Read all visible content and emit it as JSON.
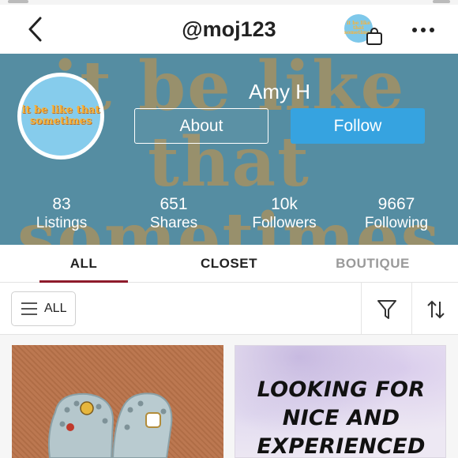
{
  "nav": {
    "title": "@moj123",
    "back_icon": "chevron-left-icon",
    "bag_icon": "shopping-bag-icon",
    "more_icon": "more-dots-icon",
    "cart_avatar_text": "it be like that sometimes"
  },
  "profile": {
    "name": "Amy H",
    "avatar_text": "it be like that sometimes",
    "banner_watermark": "it be like that sometimes",
    "about_label": "About",
    "follow_label": "Follow",
    "stats": [
      {
        "value": "83",
        "label": "Listings"
      },
      {
        "value": "651",
        "label": "Shares"
      },
      {
        "value": "10k",
        "label": "Followers"
      },
      {
        "value": "9667",
        "label": "Following"
      }
    ]
  },
  "tabs": [
    {
      "label": "ALL",
      "active": true
    },
    {
      "label": "CLOSET",
      "active": false
    },
    {
      "label": "BOUTIQUE",
      "active": false
    }
  ],
  "filters": {
    "all_label": "ALL",
    "menu_icon": "hamburger-menu-icon",
    "filter_icon": "funnel-filter-icon",
    "sort_icon": "sort-arrows-icon"
  },
  "listings": [
    {
      "image": "clogs-photo"
    },
    {
      "headline": "LOOKING FOR NICE AND EXPERIENCED"
    }
  ],
  "colors": {
    "banner": "#5b94aa",
    "follow_button": "#36a3e0",
    "tab_indicator": "#8e1b2b",
    "watermark": "#c89a52"
  }
}
